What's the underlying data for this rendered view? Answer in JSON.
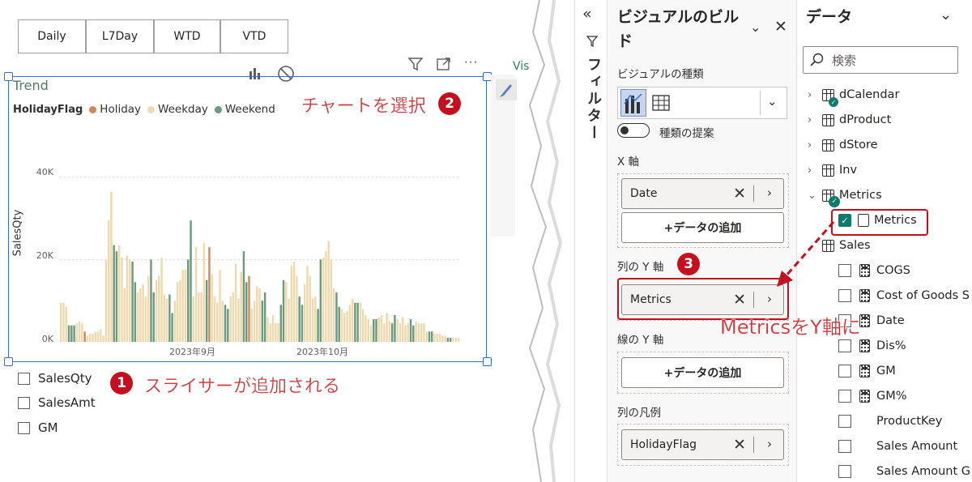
{
  "slicer": {
    "buttons": [
      "Daily",
      "L7Day",
      "WTD",
      "VTD"
    ]
  },
  "visual": {
    "title": "Trend",
    "legend_title": "HolidayFlag",
    "side_label": "Vis"
  },
  "chart_data": {
    "type": "bar",
    "title": "Trend",
    "ylabel": "SalesQty",
    "ylim": [
      0,
      50000
    ],
    "yticks": [
      "0K",
      "20K",
      "40K"
    ],
    "xticks": [
      "2023年9月",
      "2023年10月"
    ],
    "legend": [
      {
        "name": "Holiday",
        "color": "#d08a5a"
      },
      {
        "name": "Weekday",
        "color": "#efd9ae"
      },
      {
        "name": "Weekend",
        "color": "#6b9a7c"
      }
    ],
    "values": [
      9500,
      9500,
      8500,
      4000,
      4000,
      4000,
      4500,
      5000,
      4500,
      2500,
      1500,
      2000,
      2000,
      2500,
      2500,
      3000,
      1500,
      20000,
      29500,
      36500,
      23500,
      22000,
      23500,
      20500,
      13000,
      21000,
      20000,
      19500,
      14500,
      12000,
      13000,
      14000,
      11000,
      16000,
      20000,
      12000,
      15000,
      16000,
      20500,
      11500,
      10500,
      11500,
      7000,
      10000,
      14500,
      15000,
      17500,
      17500,
      20000,
      29500,
      11000,
      23000,
      12000,
      12000,
      24000,
      15000,
      23000,
      16500,
      11000,
      9500,
      17500,
      10000,
      9000,
      8000,
      11000,
      12000,
      19000,
      10500,
      17000,
      22000,
      14500,
      16000,
      8000,
      10000,
      13500,
      13000,
      10000,
      12000,
      6000,
      4500,
      6500,
      4500,
      4500,
      9000,
      15000,
      14500,
      10500,
      18500,
      19500,
      16000,
      11000,
      9000,
      14000,
      18500,
      16000,
      10500,
      11000,
      8000,
      20000,
      20500,
      22000,
      24500,
      20000,
      13000,
      12000,
      8500,
      8000,
      7000,
      7500,
      9000,
      10500,
      9500,
      9500,
      9500,
      8000,
      6500,
      5500,
      4000,
      5500,
      5500,
      6000,
      6500,
      4500,
      7000,
      5000,
      4500,
      6500,
      5500,
      4500,
      6000,
      4000,
      4500,
      5500,
      4000,
      5000,
      4500,
      4500,
      4500,
      2500,
      2500,
      2500,
      2000,
      2000,
      2000,
      1500,
      1500,
      1000,
      1000,
      1000,
      1000,
      1000
    ],
    "categories_kind": [
      "weekday",
      "weekday",
      "weekday",
      "weekend",
      "weekend",
      "weekend",
      "weekday",
      "weekday",
      "weekday",
      "holiday",
      "weekday",
      "weekday",
      "weekday",
      "weekday",
      "weekday",
      "weekday",
      "weekday",
      "weekday",
      "weekday",
      "weekday",
      "weekend",
      "weekend",
      "weekday",
      "weekday",
      "weekday",
      "weekday",
      "weekday",
      "weekend",
      "weekend",
      "weekday",
      "weekday",
      "weekday",
      "weekday",
      "weekday",
      "weekend",
      "weekend",
      "weekday",
      "weekday",
      "weekday",
      "weekday",
      "weekday",
      "weekend",
      "weekend",
      "weekday",
      "weekday",
      "weekday",
      "weekday",
      "weekday",
      "weekend",
      "weekend",
      "weekday",
      "weekday",
      "weekday",
      "weekday",
      "weekday",
      "weekend",
      "holiday",
      "weekday",
      "weekday",
      "weekday",
      "weekday",
      "weekday",
      "weekend",
      "weekend",
      "weekday",
      "weekday",
      "weekday",
      "weekday",
      "weekday",
      "weekend",
      "weekend",
      "holiday",
      "weekday",
      "weekday",
      "weekday",
      "weekday",
      "weekend",
      "weekend",
      "weekday",
      "weekday",
      "weekday",
      "weekday",
      "weekday",
      "weekend",
      "weekend",
      "weekday",
      "weekday",
      "weekday",
      "weekday",
      "weekday",
      "weekend",
      "weekend",
      "weekday",
      "weekday",
      "weekday",
      "weekday",
      "weekday",
      "weekend",
      "weekend",
      "weekday",
      "weekday",
      "weekday",
      "weekday",
      "weekday",
      "weekend",
      "weekend",
      "weekday",
      "weekday",
      "weekday",
      "weekday",
      "weekday",
      "weekend",
      "weekend",
      "weekday",
      "weekday",
      "weekday",
      "weekday",
      "weekday",
      "weekend",
      "weekend",
      "weekday",
      "weekday",
      "weekday",
      "weekday",
      "weekday",
      "weekend",
      "weekend",
      "weekday",
      "weekday",
      "weekday",
      "weekday",
      "weekday",
      "weekend",
      "weekend",
      "weekday",
      "weekday",
      "weekday",
      "weekday",
      "weekday",
      "weekend",
      "weekend",
      "weekday",
      "weekday",
      "weekday",
      "weekday",
      "weekday",
      "weekend",
      "weekend",
      "weekday",
      "weekday",
      "weekday",
      "weekday",
      "weekday",
      "weekend",
      "weekend",
      "weekday"
    ]
  },
  "field_param_slicer": {
    "items": [
      "SalesQty",
      "SalesAmt",
      "GM"
    ]
  },
  "annotations": {
    "step1": {
      "num": "1",
      "text": "スライサーが追加される"
    },
    "step2": {
      "num": "2",
      "text": "チャートを選択"
    },
    "step3": {
      "num": "3"
    },
    "arrow_text": "MetricsをY軸に"
  },
  "filter_pane": {
    "label": "フィルター"
  },
  "build_pane": {
    "title": "ビジュアルのビルド",
    "visual_type_label": "ビジュアルの種類",
    "suggest_label": "種類の提案",
    "x_axis_label": "X 軸",
    "x_axis_field": "Date",
    "add_data": "+データの追加",
    "col_y_label": "列の Y 軸",
    "col_y_field": "Metrics",
    "line_y_label": "線の Y 軸",
    "legend_label": "列の凡例",
    "legend_field": "HolidayFlag"
  },
  "data_pane": {
    "title": "データ",
    "search_placeholder": "検索",
    "tables": [
      "dCalendar",
      "dProduct",
      "dStore",
      "Inv",
      "Metrics"
    ],
    "metrics_child": "Metrics",
    "sales_table": "Sales",
    "sales_fields": [
      "COGS",
      "Cost of Goods S",
      "Date",
      "Dis%",
      "GM",
      "GM%",
      "ProductKey",
      "Sales Amount",
      "Sales Amount G"
    ]
  }
}
